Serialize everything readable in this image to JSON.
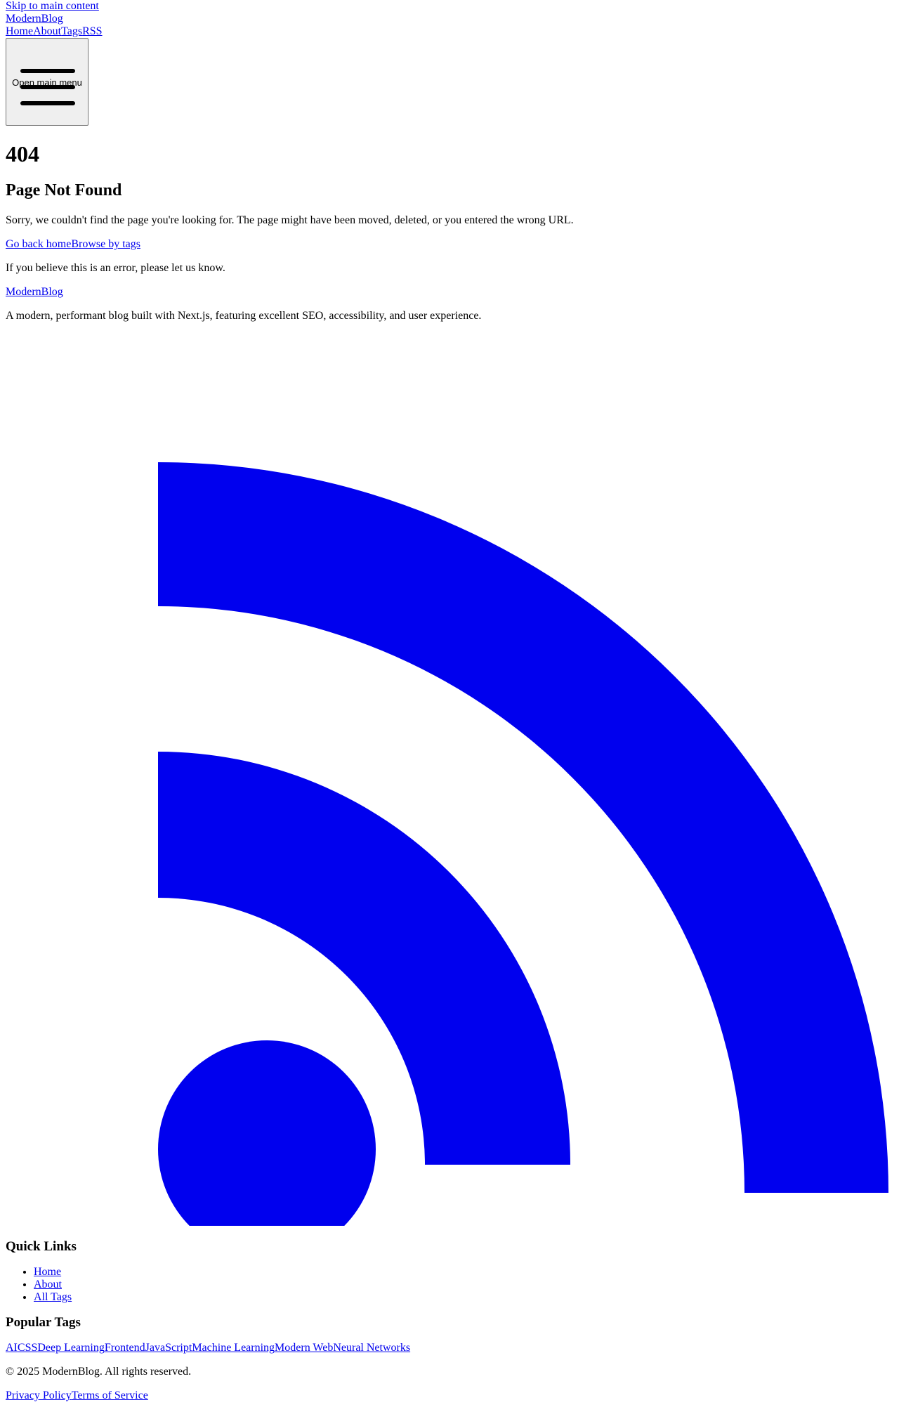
{
  "skip_link": "Skip to main content",
  "brand": {
    "part1": "Modern",
    "part2": "Blog"
  },
  "nav": {
    "home": "Home",
    "about": "About",
    "tags": "Tags",
    "rss": "RSS"
  },
  "menu_button": {
    "label": "Open main menu",
    "icon": "hamburger-icon"
  },
  "error": {
    "code": "404",
    "title": "Page Not Found",
    "message": "Sorry, we couldn't find the page you're looking for. The page might have been moved, deleted, or you entered the wrong URL.",
    "go_home": "Go back home",
    "browse_tags": "Browse by tags",
    "note": "If you believe this is an error, please let us know."
  },
  "footer": {
    "brand": {
      "part1": "Modern",
      "part2": "Blog"
    },
    "description": "A modern, performant blog built with Next.js, featuring excellent SEO, accessibility, and user experience.",
    "rss_icon": "rss-icon",
    "rss_color": "#0000ee",
    "quick_links_title": "Quick Links",
    "quick_links": [
      "Home",
      "About",
      "All Tags"
    ],
    "popular_tags_title": "Popular Tags",
    "popular_tags": [
      "AI",
      "CSS",
      "Deep Learning",
      "Frontend",
      "JavaScript",
      "Machine Learning",
      "Modern Web",
      "Neural Networks"
    ],
    "copyright": "© 2025 ModernBlog. All rights reserved.",
    "privacy": "Privacy Policy",
    "terms": "Terms of Service"
  }
}
